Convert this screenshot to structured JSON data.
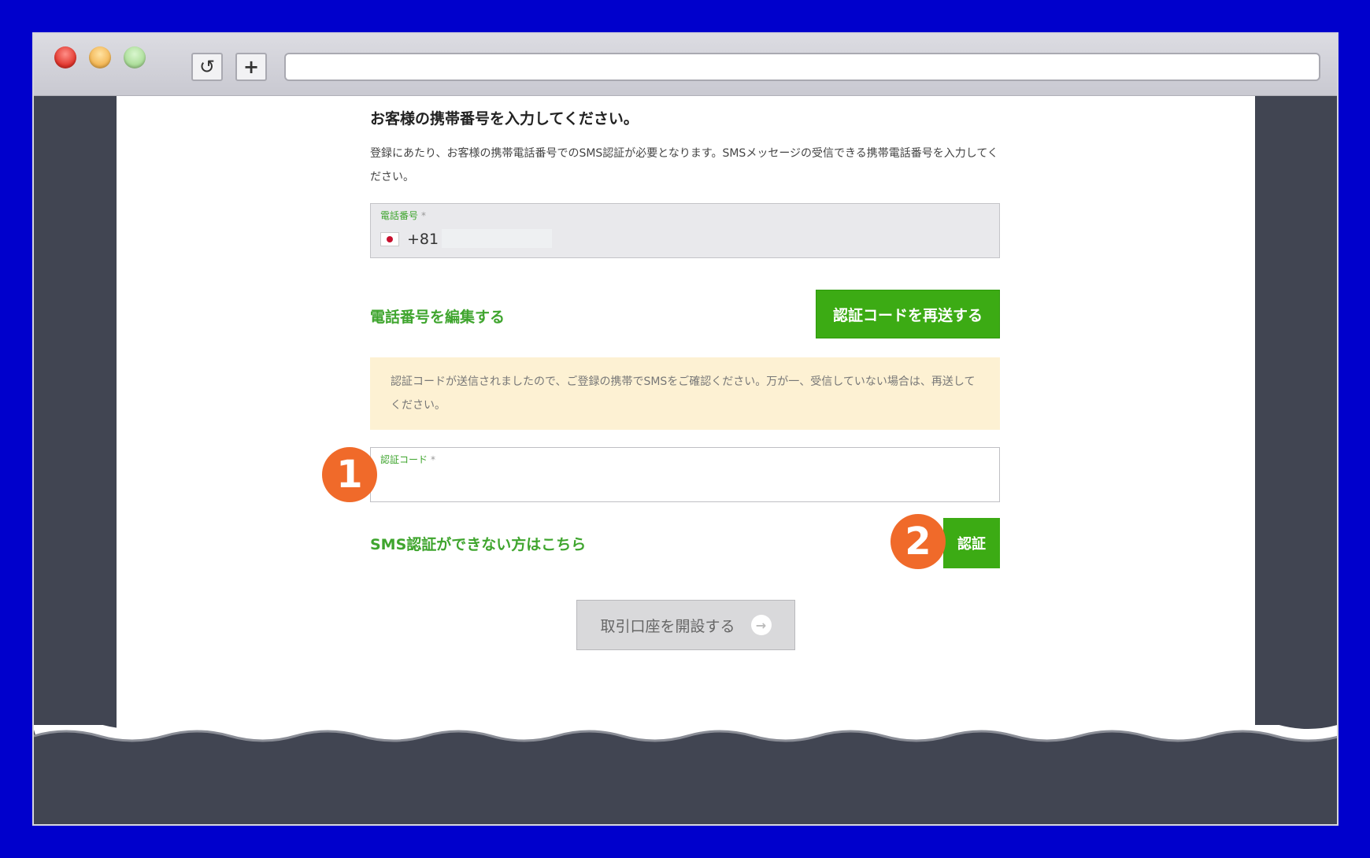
{
  "browser": {
    "reload_icon": "↺",
    "newtab_icon": "+",
    "url": ""
  },
  "form": {
    "heading": "お客様の携帯番号を入力してください。",
    "description": "登録にあたり、お客様の携帯電話番号でのSMS認証が必要となります。SMSメッセージの受信できる携帯電話番号を入力してください。",
    "phone_label": "電話番号",
    "required_mark": "*",
    "country_code": "+81",
    "edit_phone_link": "電話番号を編集する",
    "resend_button": "認証コードを再送する",
    "notice": "認証コードが送信されましたので、ご登録の携帯でSMSをご確認ください。万が一、受信していない場合は、再送してください。",
    "code_label": "認証コード",
    "code_value": "",
    "sms_help_link": "SMS認証ができない方はこちら",
    "verify_button": "認証",
    "open_account_button": "取引口座を開設する",
    "open_account_icon": "→"
  },
  "annotations": {
    "step1": "1",
    "step2": "2",
    "color": "#f06a2a"
  },
  "colors": {
    "background": "#0000cc",
    "accent_green": "#3cab14",
    "notice_bg": "#fdf1d3"
  }
}
